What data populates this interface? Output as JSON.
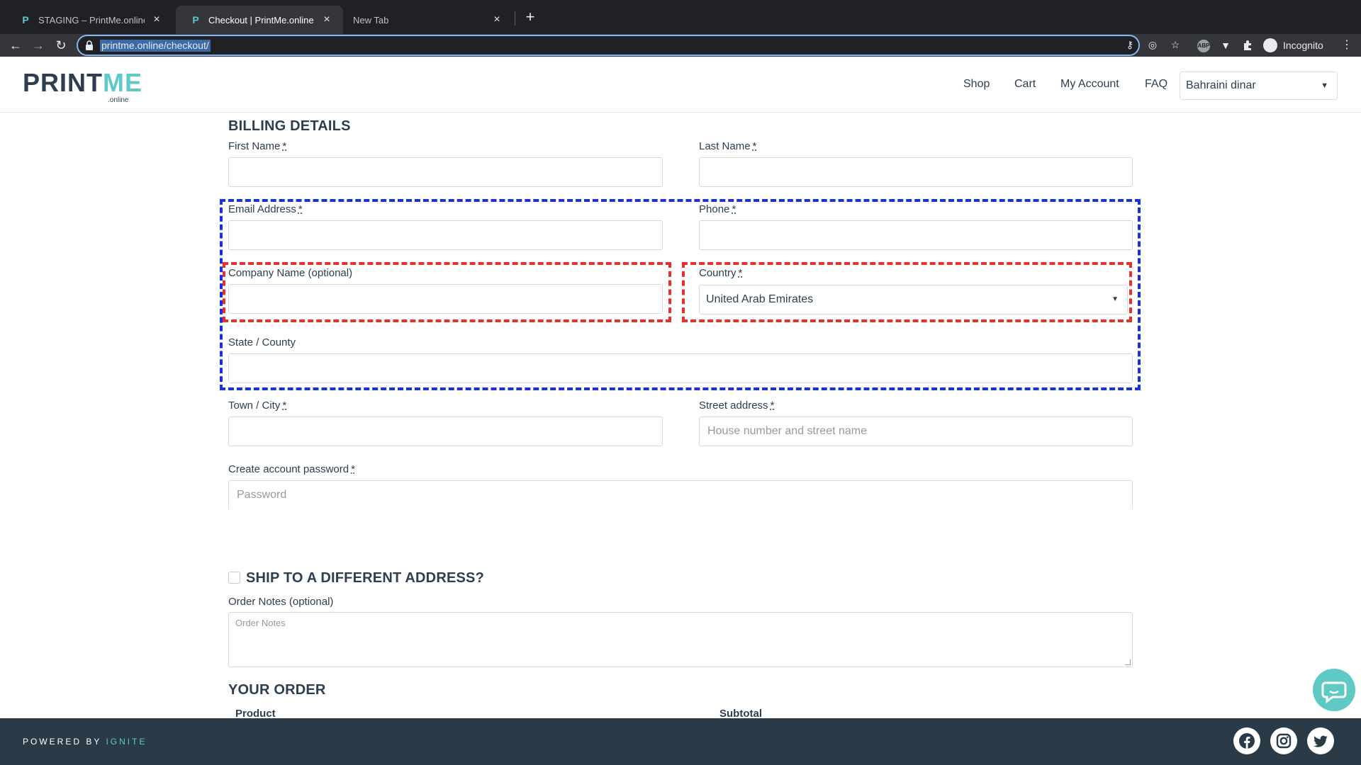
{
  "browser": {
    "tabs": [
      {
        "title": "STAGING – PrintMe.online | De",
        "favicon": "P"
      },
      {
        "title": "Checkout | PrintMe.online",
        "favicon": "P"
      },
      {
        "title": "New Tab",
        "favicon": ""
      }
    ],
    "url": "printme.online/checkout/",
    "profile_label": "Incognito",
    "ext_abp": "ABP"
  },
  "site": {
    "logo_print": "PRINT",
    "logo_me": "ME",
    "logo_sub": ".online",
    "nav": [
      "Shop",
      "Cart",
      "My Account",
      "FAQ"
    ],
    "currency": "Bahraini dinar"
  },
  "billing": {
    "title": "BILLING DETAILS",
    "first_name": "First Name",
    "last_name": "Last Name",
    "email": "Email Address",
    "phone": "Phone",
    "company": "Company Name (optional)",
    "country": "Country",
    "country_value": "United Arab Emirates",
    "state": "State / County",
    "town": "Town / City",
    "street": "Street address",
    "street_placeholder": "House number and street name",
    "password": "Create account password",
    "password_placeholder": "Password",
    "required_mark": "*"
  },
  "shipping": {
    "title": "SHIP TO A DIFFERENT ADDRESS?",
    "notes_label": "Order Notes (optional)",
    "notes_placeholder": "Order Notes"
  },
  "order": {
    "title": "YOUR ORDER",
    "col_product": "Product",
    "col_subtotal": "Subtotal"
  },
  "footer": {
    "powered_by": "POWERED BY ",
    "brand": "IGNITE"
  },
  "colors": {
    "accent": "#5fc9c6",
    "text": "#2c3e50",
    "footer_bg": "#2a3b47",
    "highlight_blue": "#1a2fe0",
    "highlight_red": "#e6302c"
  }
}
